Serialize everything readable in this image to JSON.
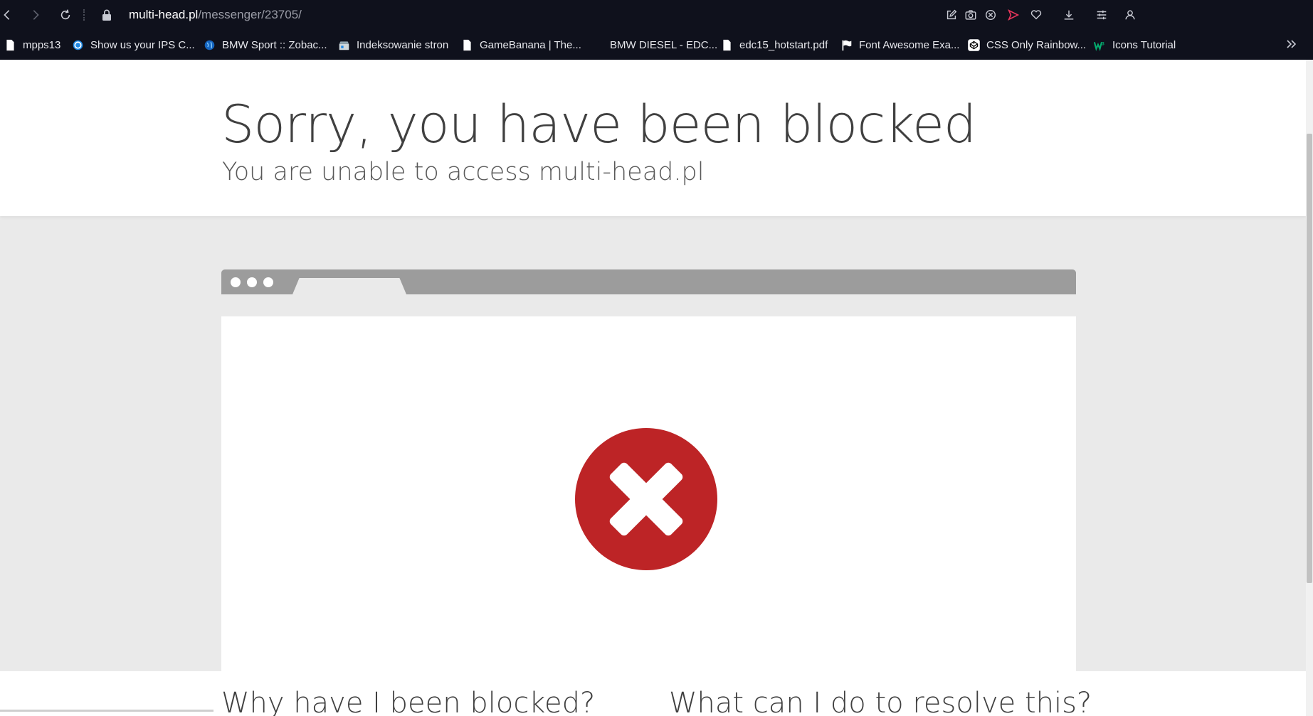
{
  "browser": {
    "url_host": "multi-head.pl",
    "url_path": "/messenger/23705/",
    "accent_color": "#e8365b",
    "icons": [
      "back-icon",
      "forward-icon",
      "reload-icon",
      "lock-icon",
      "edit-icon",
      "camera-icon",
      "block-icon",
      "send-icon",
      "heart-icon",
      "download-icon",
      "menu-icon",
      "profile-icon"
    ]
  },
  "bookmarks": [
    {
      "label": "mpps13",
      "icon": "file-icon"
    },
    {
      "label": "Show us your IPS C...",
      "icon": "ring-icon"
    },
    {
      "label": "BMW Sport :: Zobac...",
      "icon": "globe-icon"
    },
    {
      "label": "Indeksowanie stron",
      "icon": "shop-icon"
    },
    {
      "label": "GameBanana | The...",
      "icon": "file-icon"
    },
    {
      "label": "BMW DIESEL - EDC...",
      "icon": "none"
    },
    {
      "label": "edc15_hotstart.pdf",
      "icon": "file-icon"
    },
    {
      "label": "Font Awesome Exa...",
      "icon": "flag-icon"
    },
    {
      "label": "CSS Only Rainbow...",
      "icon": "codepen-icon"
    },
    {
      "label": "Icons Tutorial",
      "icon": "w3-icon"
    }
  ],
  "page": {
    "title": "Sorry, you have been blocked",
    "subtitle": "You are unable to access multi-head.pl",
    "section_left": "Why have I been blocked?",
    "section_right": "What can I do to resolve this?",
    "error_color": "#bd2426"
  }
}
